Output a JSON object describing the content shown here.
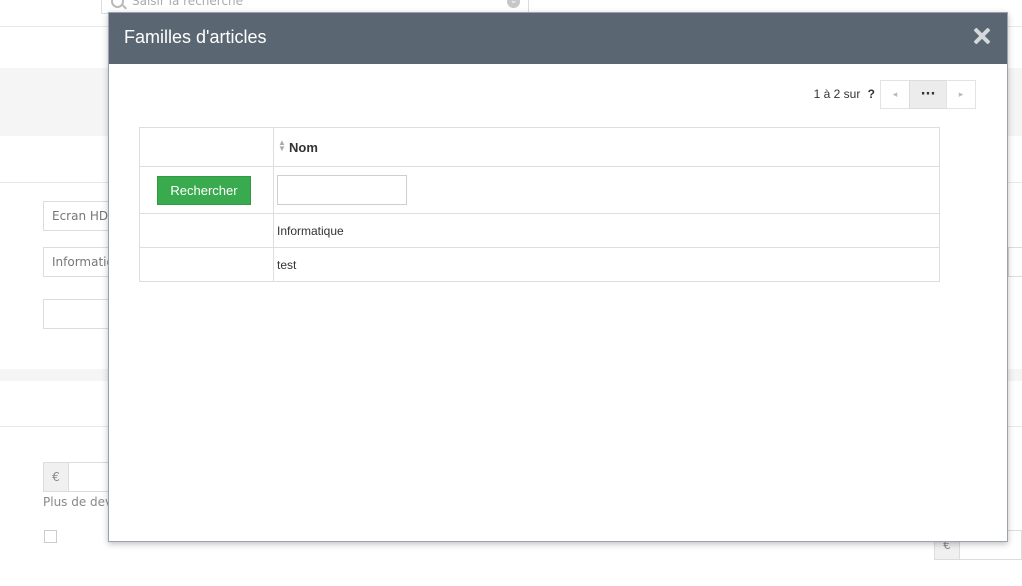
{
  "background": {
    "search_placeholder": "Saisir la recherche",
    "field_1": "Ecran HD",
    "field_2": "Informatique",
    "currency_1": "€",
    "currency_2": "€",
    "more_currencies": "Plus de devises"
  },
  "modal": {
    "title": "Familles d'articles",
    "pager": {
      "range": "1 à 2",
      "of_label": "sur",
      "total": "?",
      "prev": "◂",
      "current": "···",
      "next": "▸"
    },
    "table": {
      "column_header": "Nom",
      "search_button": "Rechercher",
      "filter_value": "",
      "rows": [
        {
          "name": "Informatique"
        },
        {
          "name": "test"
        }
      ]
    }
  },
  "colors": {
    "header_bg": "#5a6773",
    "search_button": "#3aaa4f"
  }
}
